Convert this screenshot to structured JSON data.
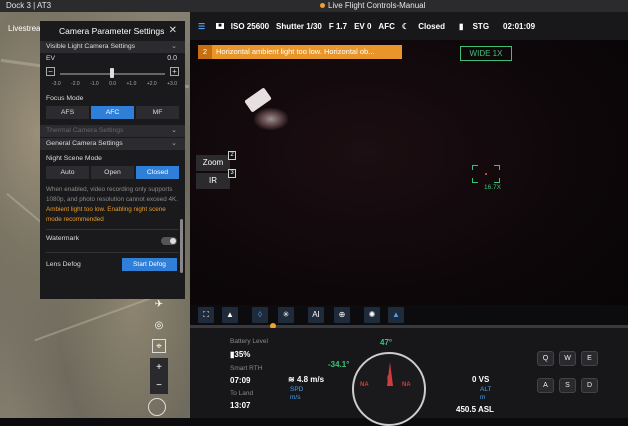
{
  "window": {
    "app": "Dock 3 | AT3",
    "title": "Live Flight Controls-Manual"
  },
  "map": {
    "livestream_label": "Livestrea"
  },
  "panel": {
    "title": "Camera Parameter Settings",
    "visible_section": "Visible Light Camera Settings",
    "ev_label": "EV",
    "ev_value": "0.0",
    "ev_ticks": [
      "-3.0",
      "-2.0",
      "-1.0",
      "0.0",
      "+1.0",
      "+2.0",
      "+3.0"
    ],
    "focus_label": "Focus Mode",
    "focus_options": [
      "AFS",
      "AFC",
      "MF"
    ],
    "focus_selected": "AFC",
    "thermal_section": "Thermal Camera Settings",
    "general_section": "General Camera Settings",
    "night_label": "Night Scene Mode",
    "night_options": [
      "Auto",
      "Open",
      "Closed"
    ],
    "night_selected": "Closed",
    "night_desc": "When enabled, video recording only supports 1080p, and photo resolution cannot exceed 4K.",
    "night_warn": "Ambient light too low. Enabling night scene mode recommended",
    "watermark_label": "Watermark",
    "watermark_on": false,
    "defog_label": "Lens Defog",
    "defog_button": "Start Defog"
  },
  "camera_bar": {
    "iso": "ISO 25600",
    "shutter": "Shutter 1/30",
    "aperture": "F 1.7",
    "ev": "EV 0",
    "focus": "AFC",
    "night": "Closed",
    "storage": "STG",
    "time": "02:01:09"
  },
  "camera": {
    "warning_num": "2",
    "warning_text": "Horizontal ambient light too low. Horizontal ob...",
    "wide": "WIDE 1X",
    "zoom_btn": "Zoom",
    "zoom_badge": "2",
    "ir_btn": "IR",
    "ir_badge": "3",
    "reticle_zoom": "16.7X"
  },
  "hud": {
    "battery_label": "Battery Level",
    "battery_value": "35%",
    "rth_label": "Smart RTH",
    "rth_value": "07:09",
    "land_label": "To Land",
    "land_value": "13:07",
    "pitch": "-34.1°",
    "heading": "47°",
    "speed": "4.8 m/s",
    "spd_label": "SPD",
    "spd_unit": "m/s",
    "vs": "0 VS",
    "alt_label": "ALT",
    "alt_unit": "m",
    "asl": "450.5 ASL",
    "compass_n": "N",
    "compass_na": "NA"
  },
  "keys": [
    "Q",
    "W",
    "E",
    "A",
    "S",
    "D"
  ],
  "colors": {
    "accent": "#2f7fd9",
    "warning": "#e8962a",
    "ok": "#3fc07a",
    "alert": "#d33c3c"
  }
}
